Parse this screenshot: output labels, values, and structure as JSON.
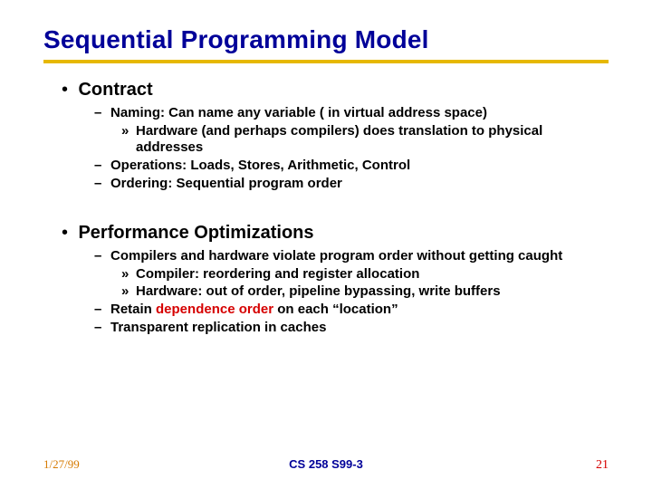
{
  "title": "Sequential Programming Model",
  "sections": [
    {
      "heading": "Contract",
      "items": [
        {
          "text": "Naming:  Can name any variable ( in virtual address space)",
          "sub": [
            {
              "text": "Hardware (and perhaps compilers) does translation to physical addresses"
            }
          ]
        },
        {
          "text": "Operations: Loads, Stores, Arithmetic, Control"
        },
        {
          "text": "Ordering:  Sequential program order"
        }
      ]
    },
    {
      "heading": "Performance Optimizations",
      "items": [
        {
          "text": "Compilers and hardware violate program order without getting caught",
          "sub": [
            {
              "text": "Compiler: reordering and register allocation"
            },
            {
              "text": "Hardware: out of order, pipeline bypassing, write buffers"
            }
          ]
        },
        {
          "text_pre": "Retain ",
          "text_red": "dependence order",
          "text_post": " on each “location”"
        },
        {
          "text": "Transparent replication in caches"
        }
      ]
    }
  ],
  "footer": {
    "date": "1/27/99",
    "center": "CS 258 S99-3",
    "page": "21"
  }
}
